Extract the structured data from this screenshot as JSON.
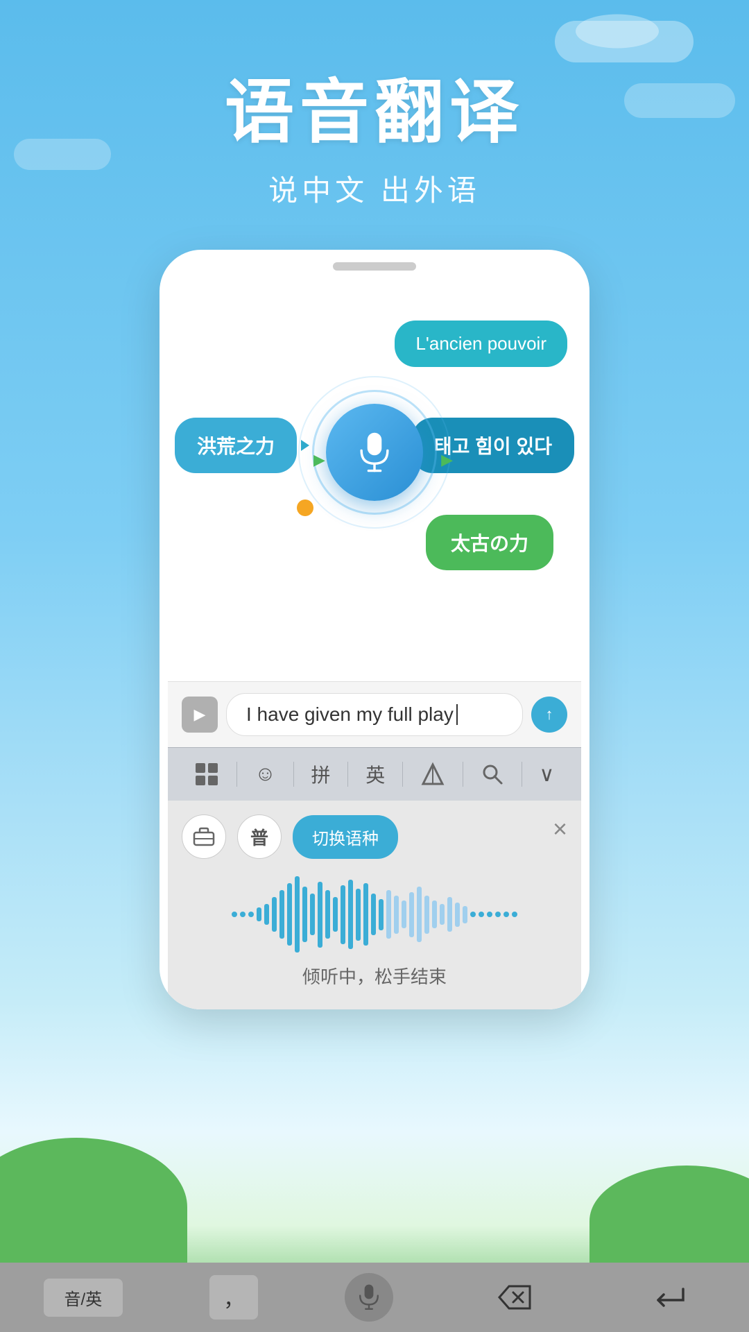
{
  "header": {
    "title": "语音翻译",
    "subtitle": "说中文 出外语"
  },
  "chat": {
    "bubble_french": "L'ancien pouvoir",
    "bubble_chinese": "洪荒之力",
    "bubble_korean": "태고 힘이 있다",
    "bubble_japanese": "太古の力"
  },
  "input": {
    "text": "I have given my full play",
    "send_icon": "↑"
  },
  "keyboard": {
    "grid_icon": "⊞",
    "emoji_icon": "☺",
    "pinyin_label": "拼",
    "english_label": "英",
    "handwrite_icon": "⌗",
    "search_icon": "🔍",
    "collapse_icon": "∨"
  },
  "voice_panel": {
    "mode_icon": "💼",
    "mode2_label": "普",
    "lang_switch_label": "切换语种",
    "close_icon": "×",
    "hint_text": "倾听中，松手结束"
  },
  "bottom_bar": {
    "lang_label": "音/英",
    "comma_label": "，",
    "mic_icon": "🎤",
    "delete_icon": "⌫",
    "enter_icon": "↵"
  },
  "colors": {
    "sky_blue": "#5bbcec",
    "teal": "#29b6c8",
    "blue": "#3badd6",
    "dark_blue": "#1a8fb8",
    "green": "#4cba5a",
    "grass": "#5cb85c",
    "wave_blue": "#3badd6",
    "wave_light": "#a0cfee"
  }
}
